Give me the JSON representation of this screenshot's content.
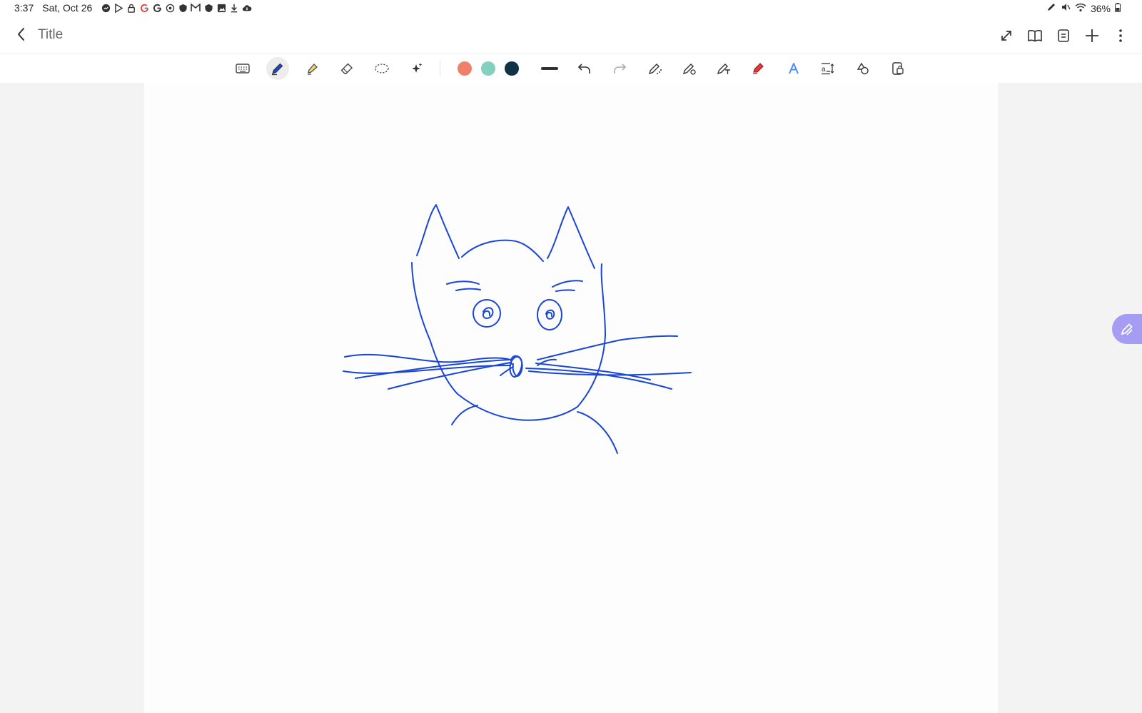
{
  "status_bar": {
    "time": "3:37",
    "date": "Sat, Oct 26",
    "notification_icons": [
      "messenger-icon",
      "play-store-icon",
      "lock-icon",
      "google-icon",
      "google-icon",
      "target-icon",
      "shield-icon",
      "gmail-icon",
      "shield-icon",
      "gallery-icon",
      "download-icon",
      "cloud-icon"
    ],
    "battery": "36%"
  },
  "app_bar": {
    "title": "Title",
    "actions": [
      "expand-icon",
      "book-icon",
      "page-list-icon",
      "add-icon",
      "more-icon"
    ]
  },
  "toolbar": {
    "tools": [
      "keyboard",
      "pen",
      "highlighter",
      "eraser",
      "lasso",
      "magic-wand"
    ],
    "selected_tool": "pen",
    "colors": [
      "#ef806a",
      "#83cfc0",
      "#0f3246"
    ],
    "stroke": "thick-line",
    "extra_tools": [
      "undo",
      "redo",
      "pen-settings",
      "shape-pen",
      "text-pen",
      "red-marker",
      "ai-text",
      "text-size",
      "shapes",
      "lock-page"
    ]
  },
  "ink_color": "#1a46d6",
  "float_button": {
    "icon": "pen-icon",
    "color": "#a49df3"
  }
}
